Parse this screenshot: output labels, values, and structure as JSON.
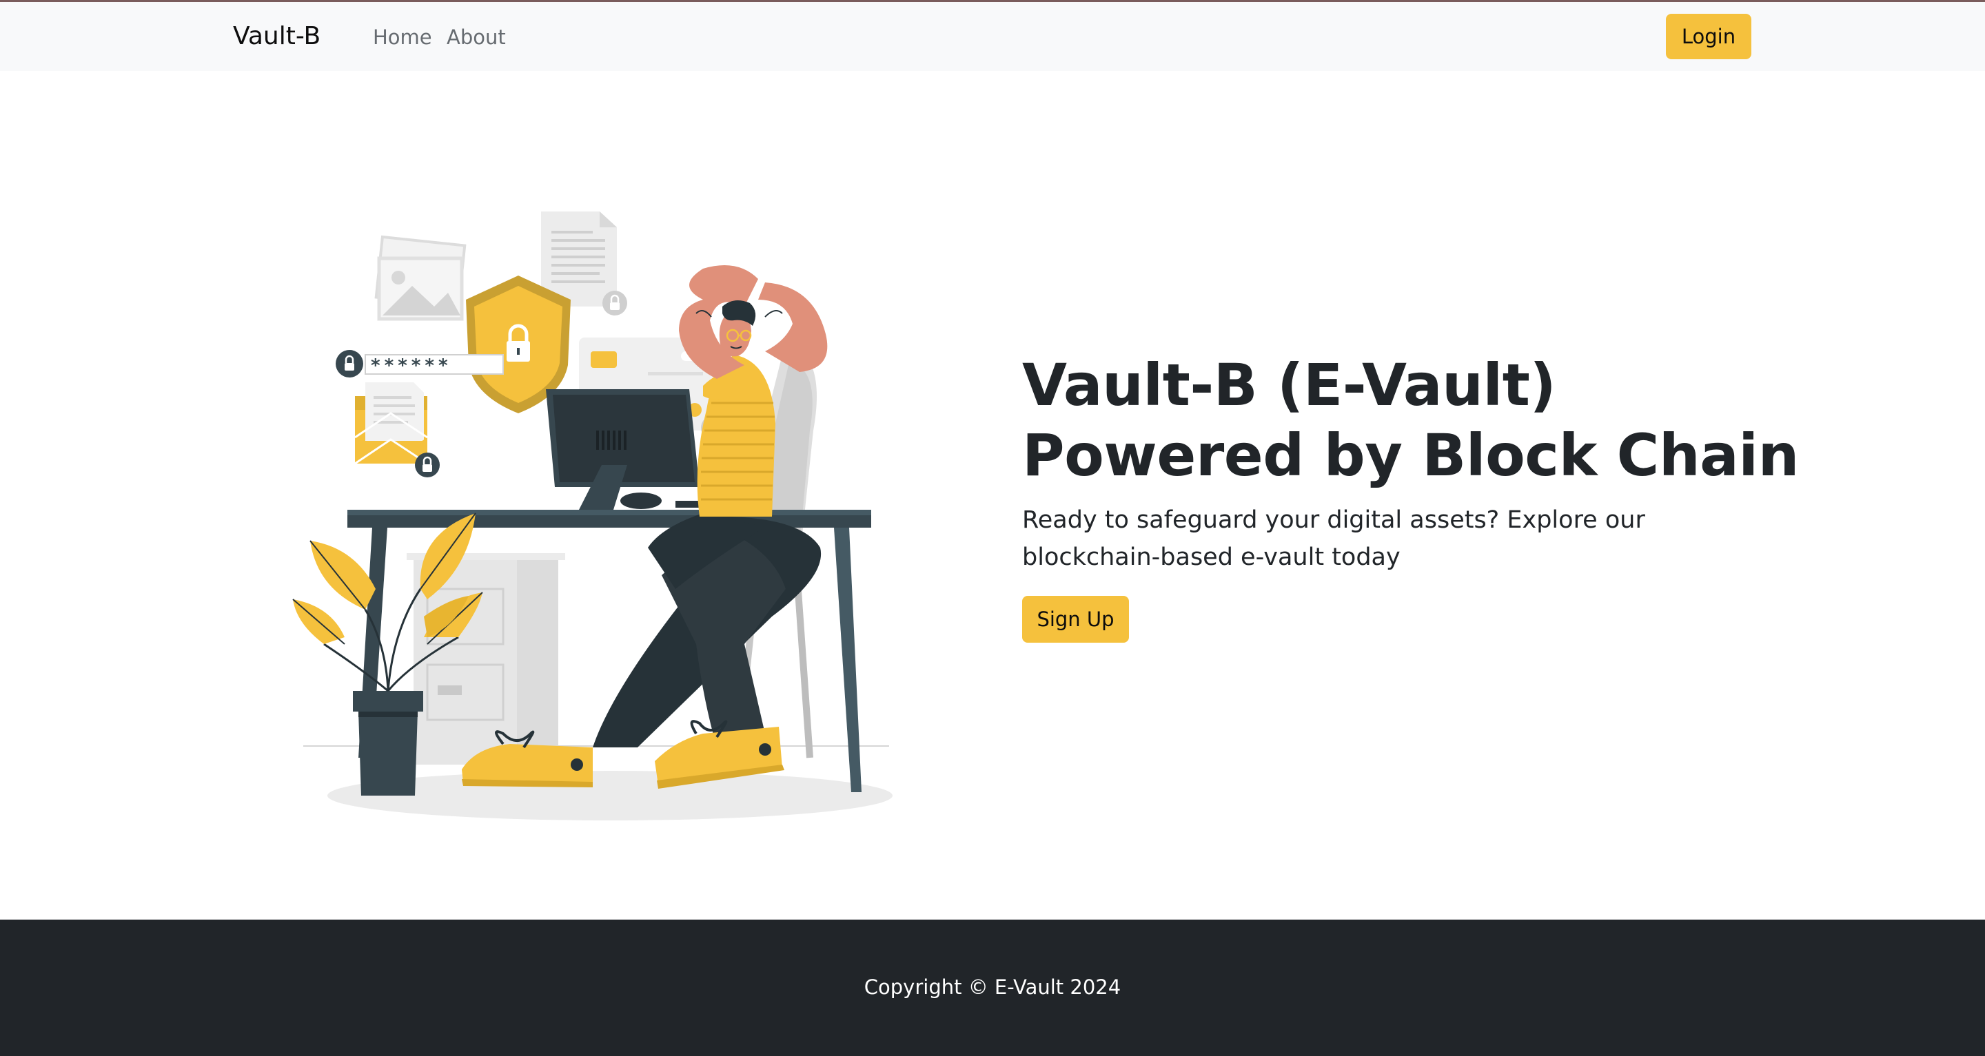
{
  "navbar": {
    "brand": "Vault-B",
    "links": [
      {
        "label": "Home"
      },
      {
        "label": "About"
      }
    ],
    "login_label": "Login"
  },
  "hero": {
    "title": "Vault-B (E-Vault) Powered by Block Chain",
    "subtitle": "Ready to safeguard your digital assets? Explore our blockchain-based e-vault today",
    "signup_label": "Sign Up",
    "password_mask": "******"
  },
  "footer": {
    "copyright": "Copyright © E-Vault 2024"
  },
  "colors": {
    "accent": "#f5c13d",
    "navbar_bg": "#f8f9fa",
    "footer_bg": "#212529",
    "text": "#212529",
    "dark_slate": "#37474f",
    "skin": "#e0907a"
  },
  "icons": {
    "illustration": "security-workspace-illustration",
    "shield": "shield-lock-icon",
    "lock": "padlock-icon"
  }
}
